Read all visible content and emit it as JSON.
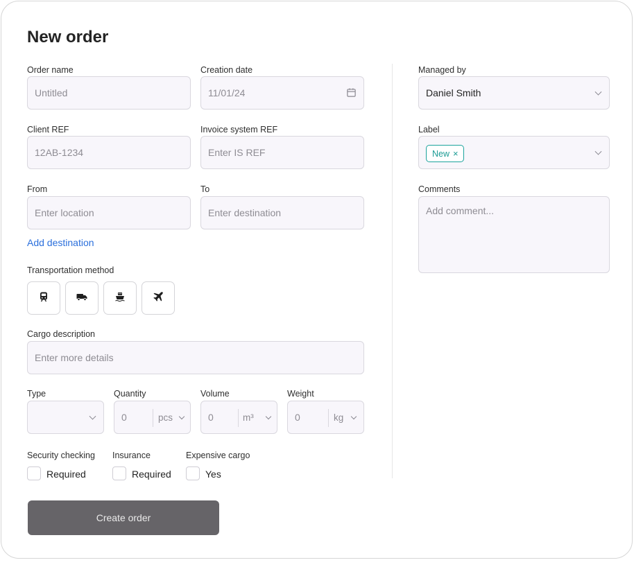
{
  "title": "New order",
  "fields": {
    "order_name": {
      "label": "Order name",
      "placeholder": "Untitled"
    },
    "creation_date": {
      "label": "Creation date",
      "value": "11/01/24"
    },
    "client_ref": {
      "label": "Client REF",
      "placeholder": "12AB-1234"
    },
    "invoice_ref": {
      "label": "Invoice system REF",
      "placeholder": "Enter IS REF"
    },
    "from": {
      "label": "From",
      "placeholder": "Enter location"
    },
    "to": {
      "label": "To",
      "placeholder": "Enter destination"
    },
    "add_destination": "Add destination",
    "transport": {
      "label": "Transportation method",
      "options": [
        "train-icon",
        "truck-icon",
        "ship-icon",
        "plane-icon"
      ]
    },
    "cargo": {
      "label": "Cargo description",
      "placeholder": "Enter more details"
    },
    "type": {
      "label": "Type",
      "value": ""
    },
    "quantity": {
      "label": "Quantity",
      "value": "0",
      "unit": "pcs"
    },
    "volume": {
      "label": "Volume",
      "value": "0",
      "unit": "m³"
    },
    "weight": {
      "label": "Weight",
      "value": "0",
      "unit": "kg"
    },
    "security": {
      "label": "Security checking",
      "option": "Required"
    },
    "insurance": {
      "label": "Insurance",
      "option": "Required"
    },
    "expensive": {
      "label": "Expensive cargo",
      "option": "Yes"
    }
  },
  "sidebar": {
    "managed_by": {
      "label": "Managed by",
      "value": "Daniel Smith"
    },
    "label": {
      "label": "Label",
      "tag": "New",
      "tag_remove": "×"
    },
    "comments": {
      "label": "Comments",
      "placeholder": "Add comment..."
    }
  },
  "submit_label": "Create order",
  "colors": {
    "accent_link": "#2a6fdc",
    "tag": "#1ba39c",
    "button": "#666468"
  }
}
